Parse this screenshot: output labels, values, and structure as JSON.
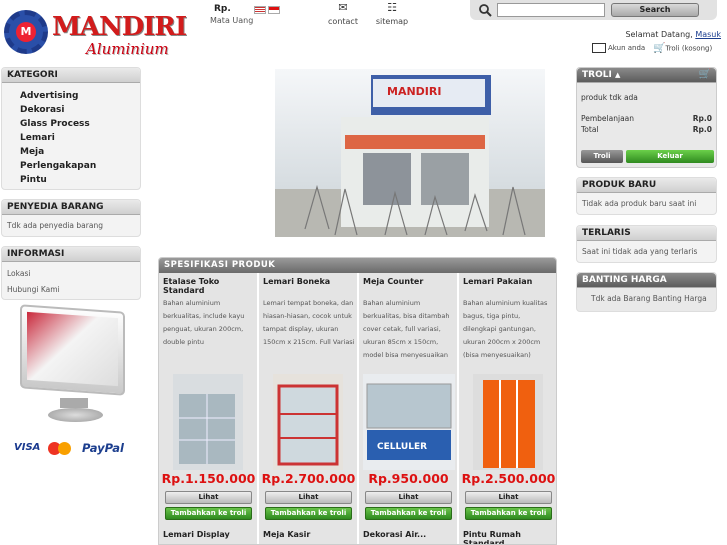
{
  "header": {
    "logo_title": "MANDIRI",
    "logo_subtitle": "Aluminium",
    "currency_symbol": "Rp.",
    "currency_label": "Mata Uang",
    "nav": [
      {
        "label": "contact",
        "icon": "envelope-icon"
      },
      {
        "label": "sitemap",
        "icon": "sitemap-icon"
      }
    ],
    "search_placeholder": "",
    "search_button": "Search",
    "welcome_text": "Selamat Datang,",
    "login_link": "Masuk",
    "account_link": "Akun anda",
    "cart_link": "Troli (kosong)"
  },
  "left": {
    "kategori_title": "KATEGORI",
    "kategori_items": [
      "Advertising",
      "Dekorasi",
      "Glass Process",
      "Lemari",
      "Meja",
      "Perlengakapan",
      "Pintu"
    ],
    "penyedia_title": "PENYEDIA BARANG",
    "penyedia_text": "Tdk ada penyedia barang",
    "informasi_title": "INFORMASI",
    "informasi_items": [
      "Lokasi",
      "Hubungi Kami"
    ],
    "payments": [
      "VISA",
      "MasterCard",
      "PayPal"
    ]
  },
  "main": {
    "spec_title": "SPESIFIKASI PRODUK",
    "products": [
      {
        "name": "Etalase Toko Standard",
        "desc": "Bahan aluminium berkualitas, include kayu penguat, ukuran 200cm, double pintu",
        "price": "Rp.1.150.000",
        "view": "Lihat",
        "add": "Tambahkan ke troli",
        "next": "Lemari Display"
      },
      {
        "name": "Lemari Boneka",
        "desc": "Lemari tempat boneka, dan hiasan-hiasan, cocok untuk tampat display, ukuran 150cm x 215cm. Full Variasi",
        "price": "Rp.2.700.000",
        "view": "Lihat",
        "add": "Tambahkan ke troli",
        "next": "Meja Kasir"
      },
      {
        "name": "Meja Counter",
        "desc": "Bahan aluminium berkualitas, bisa ditambah cover cetak, full variasi, ukuran 85cm x 150cm, model bisa menyesuaikan",
        "price": "Rp.950.000",
        "view": "Lihat",
        "add": "Tambahkan ke troli",
        "next": "Dekorasi Air..."
      },
      {
        "name": "Lemari Pakaian",
        "desc": "Bahan aluminium kualitas bagus, tiga pintu, dilengkapi gantungan, ukuran 200cm x 200cm (bisa menyesuaikan)",
        "price": "Rp.2.500.000",
        "view": "Lihat",
        "add": "Tambahkan ke troli",
        "next": "Pintu Rumah Standard"
      }
    ],
    "counter_sign": "CELLULER"
  },
  "right": {
    "troli_title": "TROLI",
    "troli_empty": "produk tdk ada",
    "pembelanjaan_label": "Pembelanjaan",
    "pembelanjaan_value": "Rp.0",
    "total_label": "Total",
    "total_value": "Rp.0",
    "troli_button": "Troli",
    "keluar_button": "Keluar",
    "baru_title": "PRODUK BARU",
    "baru_text": "Tidak ada produk baru saat ini",
    "terlaris_title": "TERLARIS",
    "terlaris_text": "Saat ini tidak ada yang terlaris",
    "banting_title": "BANTING HARGA",
    "banting_text": "Tdk ada Barang Banting Harga"
  },
  "colors": {
    "price": "#dd1111",
    "add_button": "#3a9a27",
    "logo": "#d21c1c"
  }
}
